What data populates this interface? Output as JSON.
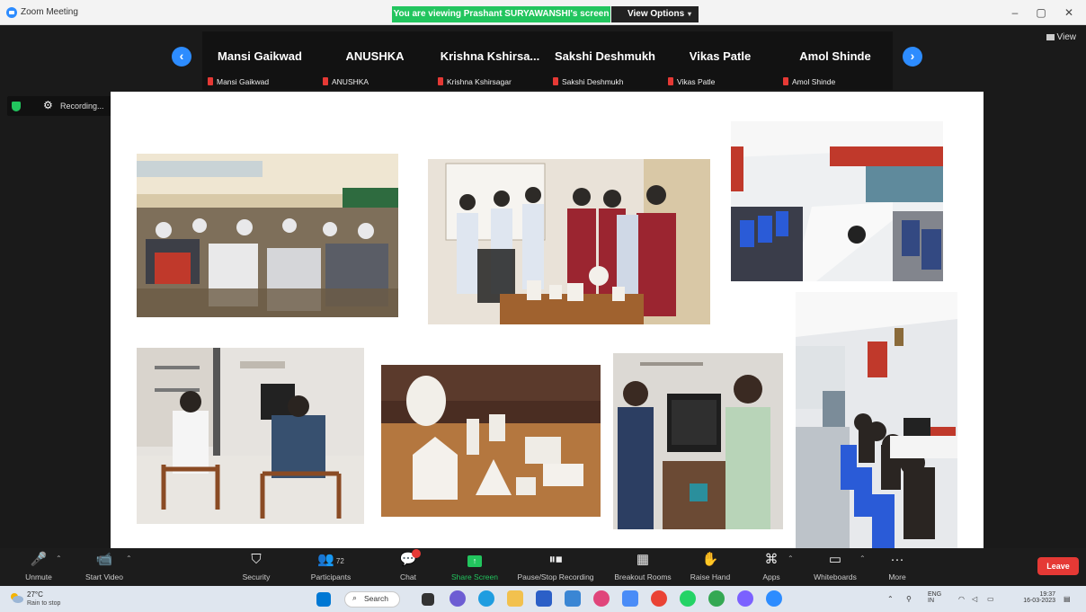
{
  "window": {
    "title": "Zoom Meeting",
    "share_banner": "You are viewing Prashant SURYAWANSHI's screen",
    "view_options": "View Options",
    "view_toggle": "View"
  },
  "gallery": {
    "participants": [
      {
        "name": "Mansi Gaikwad",
        "label": "Mansi Gaikwad"
      },
      {
        "name": "ANUSHKA",
        "label": "ANUSHKA"
      },
      {
        "name": "Krishna  Kshirsa...",
        "label": "Krishna Kshirsagar"
      },
      {
        "name": "Sakshi Deshmukh",
        "label": "Sakshi Deshmukh"
      },
      {
        "name": "Vikas Patle",
        "label": "Vikas Patle"
      },
      {
        "name": "Amol Shinde",
        "label": "Amol Shinde"
      }
    ]
  },
  "recording": {
    "label": "Recording..."
  },
  "toolbar": {
    "unmute": "Unmute",
    "start_video": "Start Video",
    "security": "Security",
    "participants": "Participants",
    "participants_count": "72",
    "chat": "Chat",
    "share_screen": "Share Screen",
    "pause_stop_recording": "Pause/Stop Recording",
    "breakout_rooms": "Breakout Rooms",
    "raise_hand": "Raise Hand",
    "apps": "Apps",
    "whiteboards": "Whiteboards",
    "more": "More",
    "leave": "Leave"
  },
  "taskbar": {
    "weather_temp": "27°C",
    "weather_desc": "Rain to stop",
    "search": "Search",
    "lang_top": "ENG",
    "lang_bottom": "IN",
    "time": "19:37",
    "date": "16-03-2023"
  },
  "colors": {
    "accent_blue": "#2d8cff",
    "share_green": "#22c55e",
    "leave_red": "#e53935",
    "toolbar_bg": "#1c1c1c"
  }
}
